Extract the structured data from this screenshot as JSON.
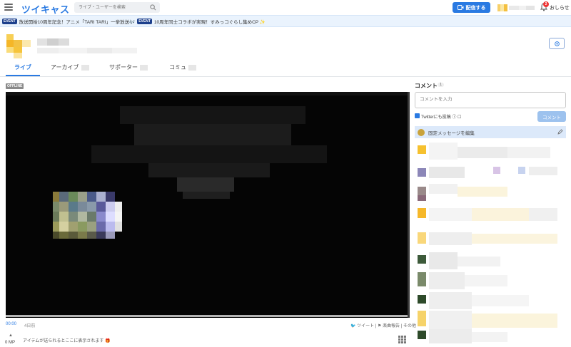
{
  "header": {
    "logo": "ツイキャス",
    "search_placeholder": "ライブ・ユーザーを検索",
    "broadcast_label": "配信する",
    "notification_count": "2",
    "notice_label": "おしらせ"
  },
  "event_bar": {
    "tag1": "EVENT",
    "text1": "放送開始10周年記念！アニメ「TARI TARI」一挙放送🎶",
    "tag2": "EVENT",
    "text2": "10周年同士コラボが実現！すみっコぐらし集めCP ✨"
  },
  "tabs": [
    {
      "label": "ライブ",
      "active": true
    },
    {
      "label": "アーカイブ",
      "active": false
    },
    {
      "label": "サポーター",
      "active": false
    },
    {
      "label": "コミュ",
      "active": false
    }
  ],
  "player": {
    "status_badge": "OFFLINE",
    "time_current": "00:00",
    "time_ago": "4日前",
    "share_links": "🐦 ツイート | ⚑ 楽曲報告 | その他",
    "mp_label": "0 MP",
    "item_text": "アイテムが送られるとここに表示されます 🎁"
  },
  "comments": {
    "title": "コメント",
    "count": "1",
    "input_placeholder": "コメントを入力",
    "twitter_label": "Twitterにも投稿 ⓘ ☐",
    "submit_label": "コメント",
    "pinned_label": "固定メッセージを編集"
  },
  "colors": {
    "accent": "#2a7ae2",
    "event_tag": "#1c3f8c",
    "player_bg": "#000000"
  }
}
